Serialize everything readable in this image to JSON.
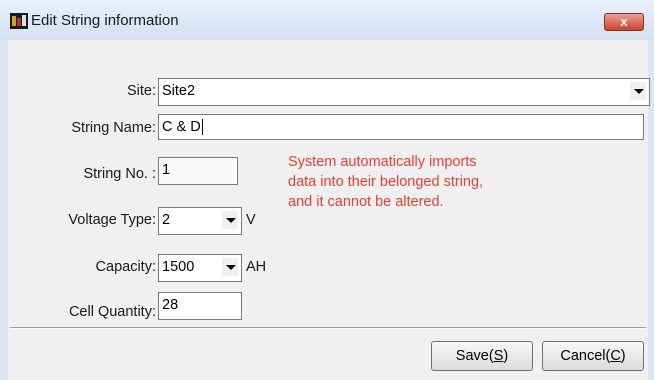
{
  "window": {
    "title": "Edit String information",
    "close_label": "x"
  },
  "form": {
    "site": {
      "label": "Site:",
      "value": "Site2"
    },
    "string_name": {
      "label": "String Name:",
      "value": "C & D"
    },
    "string_no": {
      "label": "String No. :",
      "value": "1"
    },
    "voltage_type": {
      "label": "Voltage Type:",
      "value": "2",
      "unit": "V"
    },
    "capacity": {
      "label": "Capacity:",
      "value": "1500",
      "unit": "AH"
    },
    "cell_quantity": {
      "label": "Cell Quantity:",
      "value": "28"
    }
  },
  "note": {
    "lines": [
      "System automatically imports",
      "data into their belonged string,",
      "and it cannot be altered."
    ],
    "color": "#e84030"
  },
  "buttons": {
    "save": {
      "text": "Save(",
      "mnemonic": "S",
      "close": ")"
    },
    "cancel": {
      "text": "Cancel(",
      "mnemonic": "C",
      "close": ")"
    }
  }
}
